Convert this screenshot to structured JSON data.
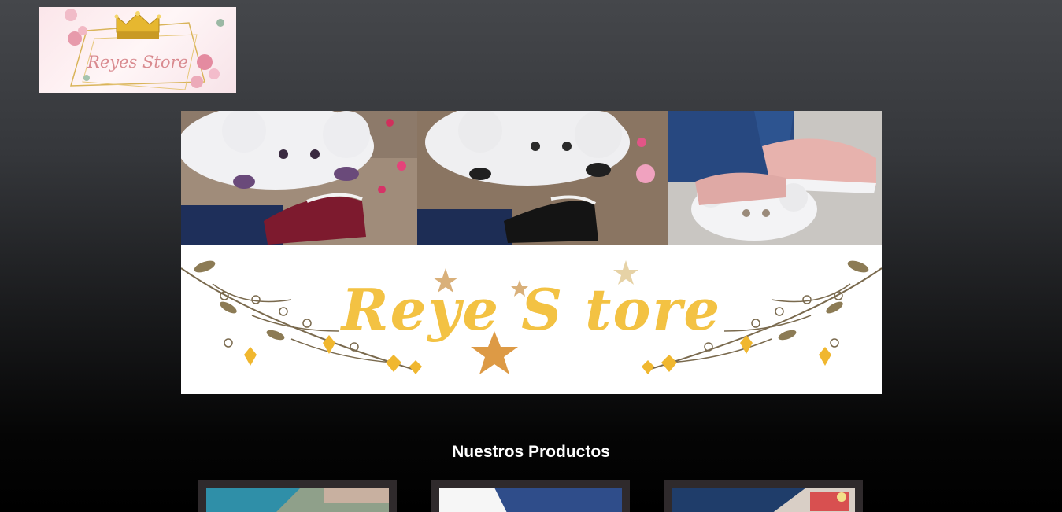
{
  "header": {
    "logo_text": "Reyes Store",
    "logo_icon": "crown-icon"
  },
  "banner": {
    "brand_text": "Reye S tore",
    "photos": [
      {
        "name": "sneaker-burgundy-bear-sole"
      },
      {
        "name": "sneaker-black-bear-sole"
      },
      {
        "name": "sneaker-pink-bear-sole"
      }
    ],
    "accent_color": "#f3c243"
  },
  "products": {
    "title": "Nuestros Productos",
    "cards": [
      {
        "name": "product-card-1"
      },
      {
        "name": "product-card-2"
      },
      {
        "name": "product-card-3"
      }
    ]
  }
}
